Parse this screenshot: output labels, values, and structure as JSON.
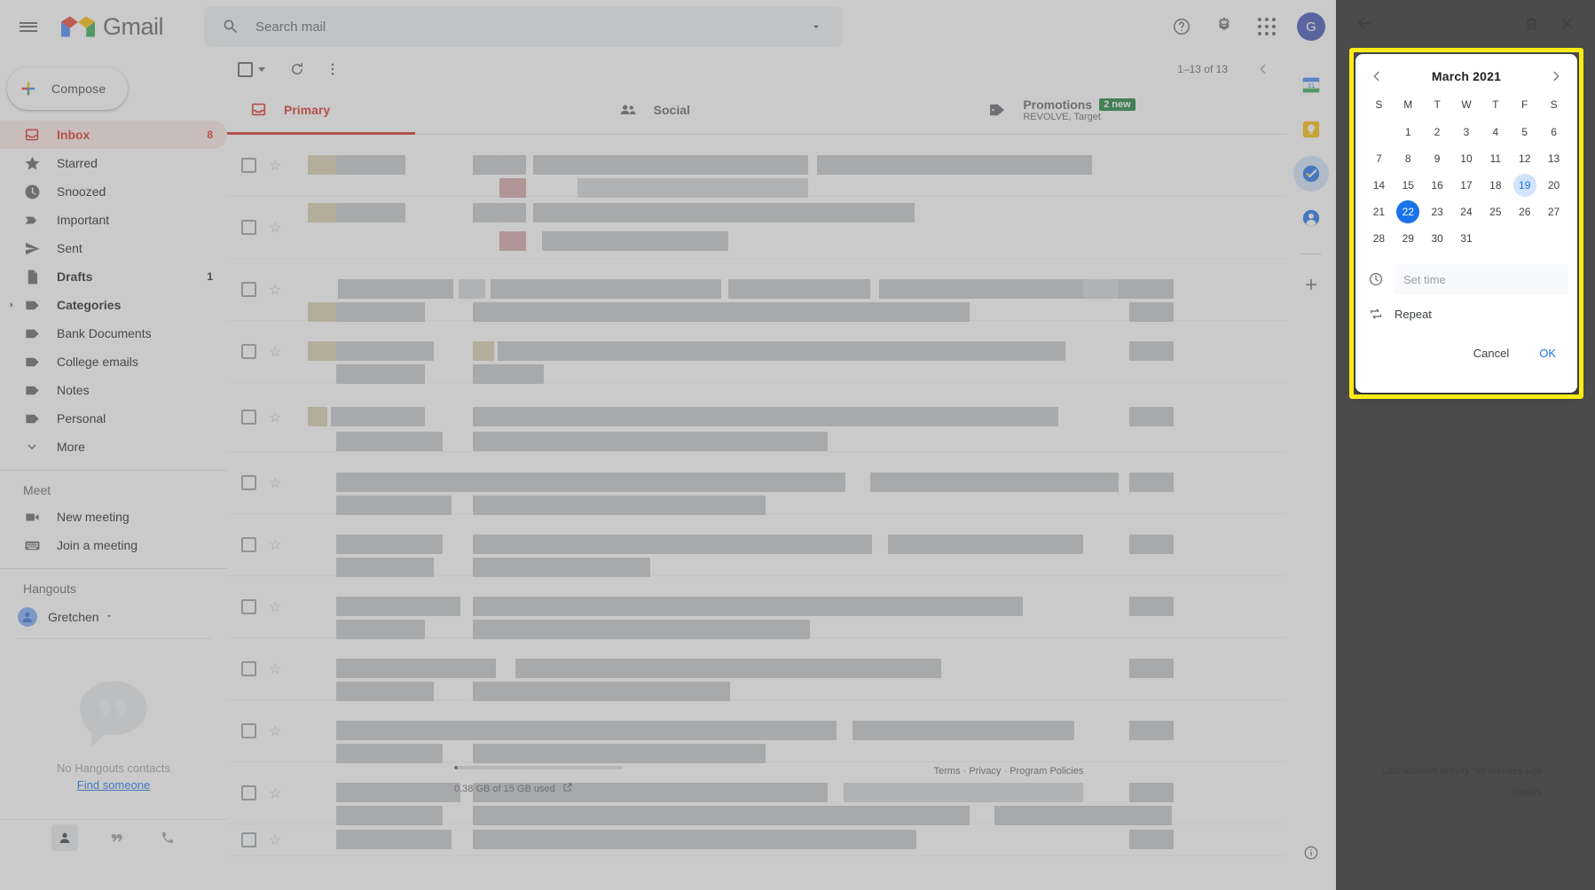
{
  "header": {
    "menu_icon": "hamburger-icon",
    "brand": "Gmail",
    "search": {
      "placeholder": "Search mail",
      "value": "",
      "icon": "search-icon",
      "options_icon": "chevron-down-icon"
    },
    "help_icon": "help-circle-icon",
    "settings_icon": "gear-icon",
    "apps_icon": "apps-grid-icon",
    "avatar_letter": "G"
  },
  "sidebar": {
    "compose_label": "Compose",
    "items": [
      {
        "label": "Inbox",
        "count": "8",
        "icon": "inbox-icon",
        "active": true,
        "bold": true
      },
      {
        "label": "Starred",
        "count": "",
        "icon": "star-icon",
        "active": false,
        "bold": false
      },
      {
        "label": "Snoozed",
        "count": "",
        "icon": "clock-icon",
        "active": false,
        "bold": false
      },
      {
        "label": "Important",
        "count": "",
        "icon": "important-marker-icon",
        "active": false,
        "bold": false
      },
      {
        "label": "Sent",
        "count": "",
        "icon": "send-icon",
        "active": false,
        "bold": false
      },
      {
        "label": "Drafts",
        "count": "1",
        "icon": "draft-icon",
        "active": false,
        "bold": true
      },
      {
        "label": "Categories",
        "count": "",
        "icon": "label-icon",
        "active": false,
        "bold": true,
        "expandable": true
      },
      {
        "label": "Bank Documents",
        "count": "",
        "icon": "label-icon",
        "active": false,
        "bold": false
      },
      {
        "label": "College emails",
        "count": "",
        "icon": "label-icon",
        "active": false,
        "bold": false
      },
      {
        "label": "Notes",
        "count": "",
        "icon": "label-icon",
        "active": false,
        "bold": false
      },
      {
        "label": "Personal",
        "count": "",
        "icon": "label-icon",
        "active": false,
        "bold": false
      },
      {
        "label": "More",
        "count": "",
        "icon": "chevron-down-icon",
        "active": false,
        "bold": false
      }
    ],
    "meet": {
      "title": "Meet",
      "new_meeting": "New meeting",
      "join_meeting": "Join a meeting"
    },
    "hangouts": {
      "title": "Hangouts",
      "user": "Gretchen",
      "add_icon": "plus-icon",
      "empty_text": "No Hangouts contacts",
      "find_link": "Find someone",
      "footer_icons": [
        "contacts-icon",
        "chat-icon",
        "phone-icon"
      ]
    }
  },
  "list": {
    "toolbar": {
      "select_all_icon": "checkbox-icon",
      "refresh_icon": "refresh-icon",
      "more_icon": "more-vertical-icon"
    },
    "pager": {
      "range": "1–13 of 13",
      "prev_icon": "chevron-left-icon",
      "next_icon": "chevron-right-icon"
    },
    "tabs": [
      {
        "label": "Primary",
        "icon": "inbox-icon",
        "active": true,
        "sub": "",
        "badge": ""
      },
      {
        "label": "Social",
        "icon": "people-icon",
        "active": false,
        "sub": "",
        "badge": ""
      },
      {
        "label": "Promotions",
        "icon": "tag-icon",
        "active": false,
        "sub": "REVOLVE, Target",
        "badge": "2 new"
      }
    ],
    "rows_count": 13
  },
  "footer": {
    "storage": "0.38 GB of 15 GB used",
    "storage_external_icon": "open-in-new-icon",
    "links": [
      "Terms",
      "Privacy",
      "Program Policies"
    ],
    "link_sep": " · ",
    "activity": "Last account activity: 59 minutes ago",
    "details": "Details"
  },
  "side_rail": {
    "items": [
      {
        "name": "google-calendar-icon",
        "active": false
      },
      {
        "name": "google-keep-icon",
        "active": false
      },
      {
        "name": "google-tasks-icon",
        "active": true
      },
      {
        "name": "google-contacts-icon",
        "active": false
      }
    ],
    "add_label": "+",
    "info_icon": "info-circle-icon"
  },
  "tasks_panel": {
    "back_icon": "arrow-back-icon",
    "delete_icon": "trash-icon",
    "close_icon": "close-icon"
  },
  "datepicker": {
    "prev_icon": "chevron-left-icon",
    "next_icon": "chevron-right-icon",
    "month_label": "March 2021",
    "weekdays": [
      "S",
      "M",
      "T",
      "W",
      "T",
      "F",
      "S"
    ],
    "leading_blanks": 1,
    "days": [
      1,
      2,
      3,
      4,
      5,
      6,
      7,
      8,
      9,
      10,
      11,
      12,
      13,
      14,
      15,
      16,
      17,
      18,
      19,
      20,
      21,
      22,
      23,
      24,
      25,
      26,
      27,
      28,
      29,
      30,
      31
    ],
    "today": 19,
    "selected": 22,
    "set_time": {
      "icon": "clock-icon",
      "placeholder": "Set time",
      "value": ""
    },
    "repeat": {
      "icon": "repeat-icon",
      "label": "Repeat"
    },
    "cancel_label": "Cancel",
    "ok_label": "OK",
    "accent_color": "#1a73e8",
    "today_color": "#d2e3fc",
    "highlight_color": "#ffeb14"
  }
}
